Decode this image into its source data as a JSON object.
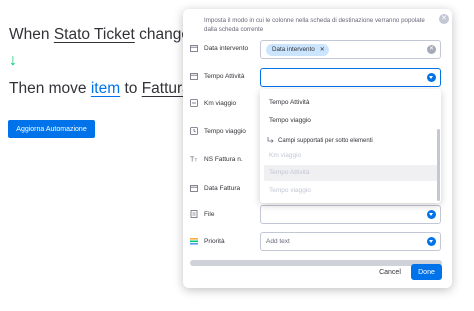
{
  "background": {
    "line1": {
      "prefix": "When ",
      "column": "Stato Ticket",
      "suffix": " changes"
    },
    "line2": {
      "prefix": "Then move ",
      "item": "item",
      "to": " to ",
      "target": "Fattura"
    },
    "update_button": "Aggiorna Automazione"
  },
  "modal": {
    "description": "Imposta il modo in cui le colonne nella scheda di destinazione verranno popolate dalla scheda corrente",
    "rows": [
      {
        "label": "Data intervento",
        "icon": "calendar-icon",
        "value_chip": "Data intervento"
      },
      {
        "label": "Tempo Attività",
        "icon": "calendar-icon"
      },
      {
        "label": "Km viaggio",
        "icon": "numbers-icon"
      },
      {
        "label": "Tempo viaggio",
        "icon": "clock-icon"
      },
      {
        "label": "NS Fattura n.",
        "icon": "text-icon"
      },
      {
        "label": "Data Fattura",
        "icon": "calendar-icon"
      },
      {
        "label": "File",
        "icon": "file-icon"
      },
      {
        "label": "Priorità",
        "icon": "status-icon",
        "placeholder": "Add text"
      }
    ],
    "dropdown": {
      "options": [
        "Tempo Attività",
        "Tempo viaggio"
      ],
      "section_title": "Campi supportati per sotto elementi",
      "sub_options": [
        "Km viaggio",
        "Tempo Attività",
        "Tempo viaggio"
      ]
    },
    "cancel": "Cancel",
    "done": "Done"
  },
  "colors": {
    "accent": "#0073ea",
    "arrow": "#00c875",
    "chip": "#cce5ff"
  }
}
